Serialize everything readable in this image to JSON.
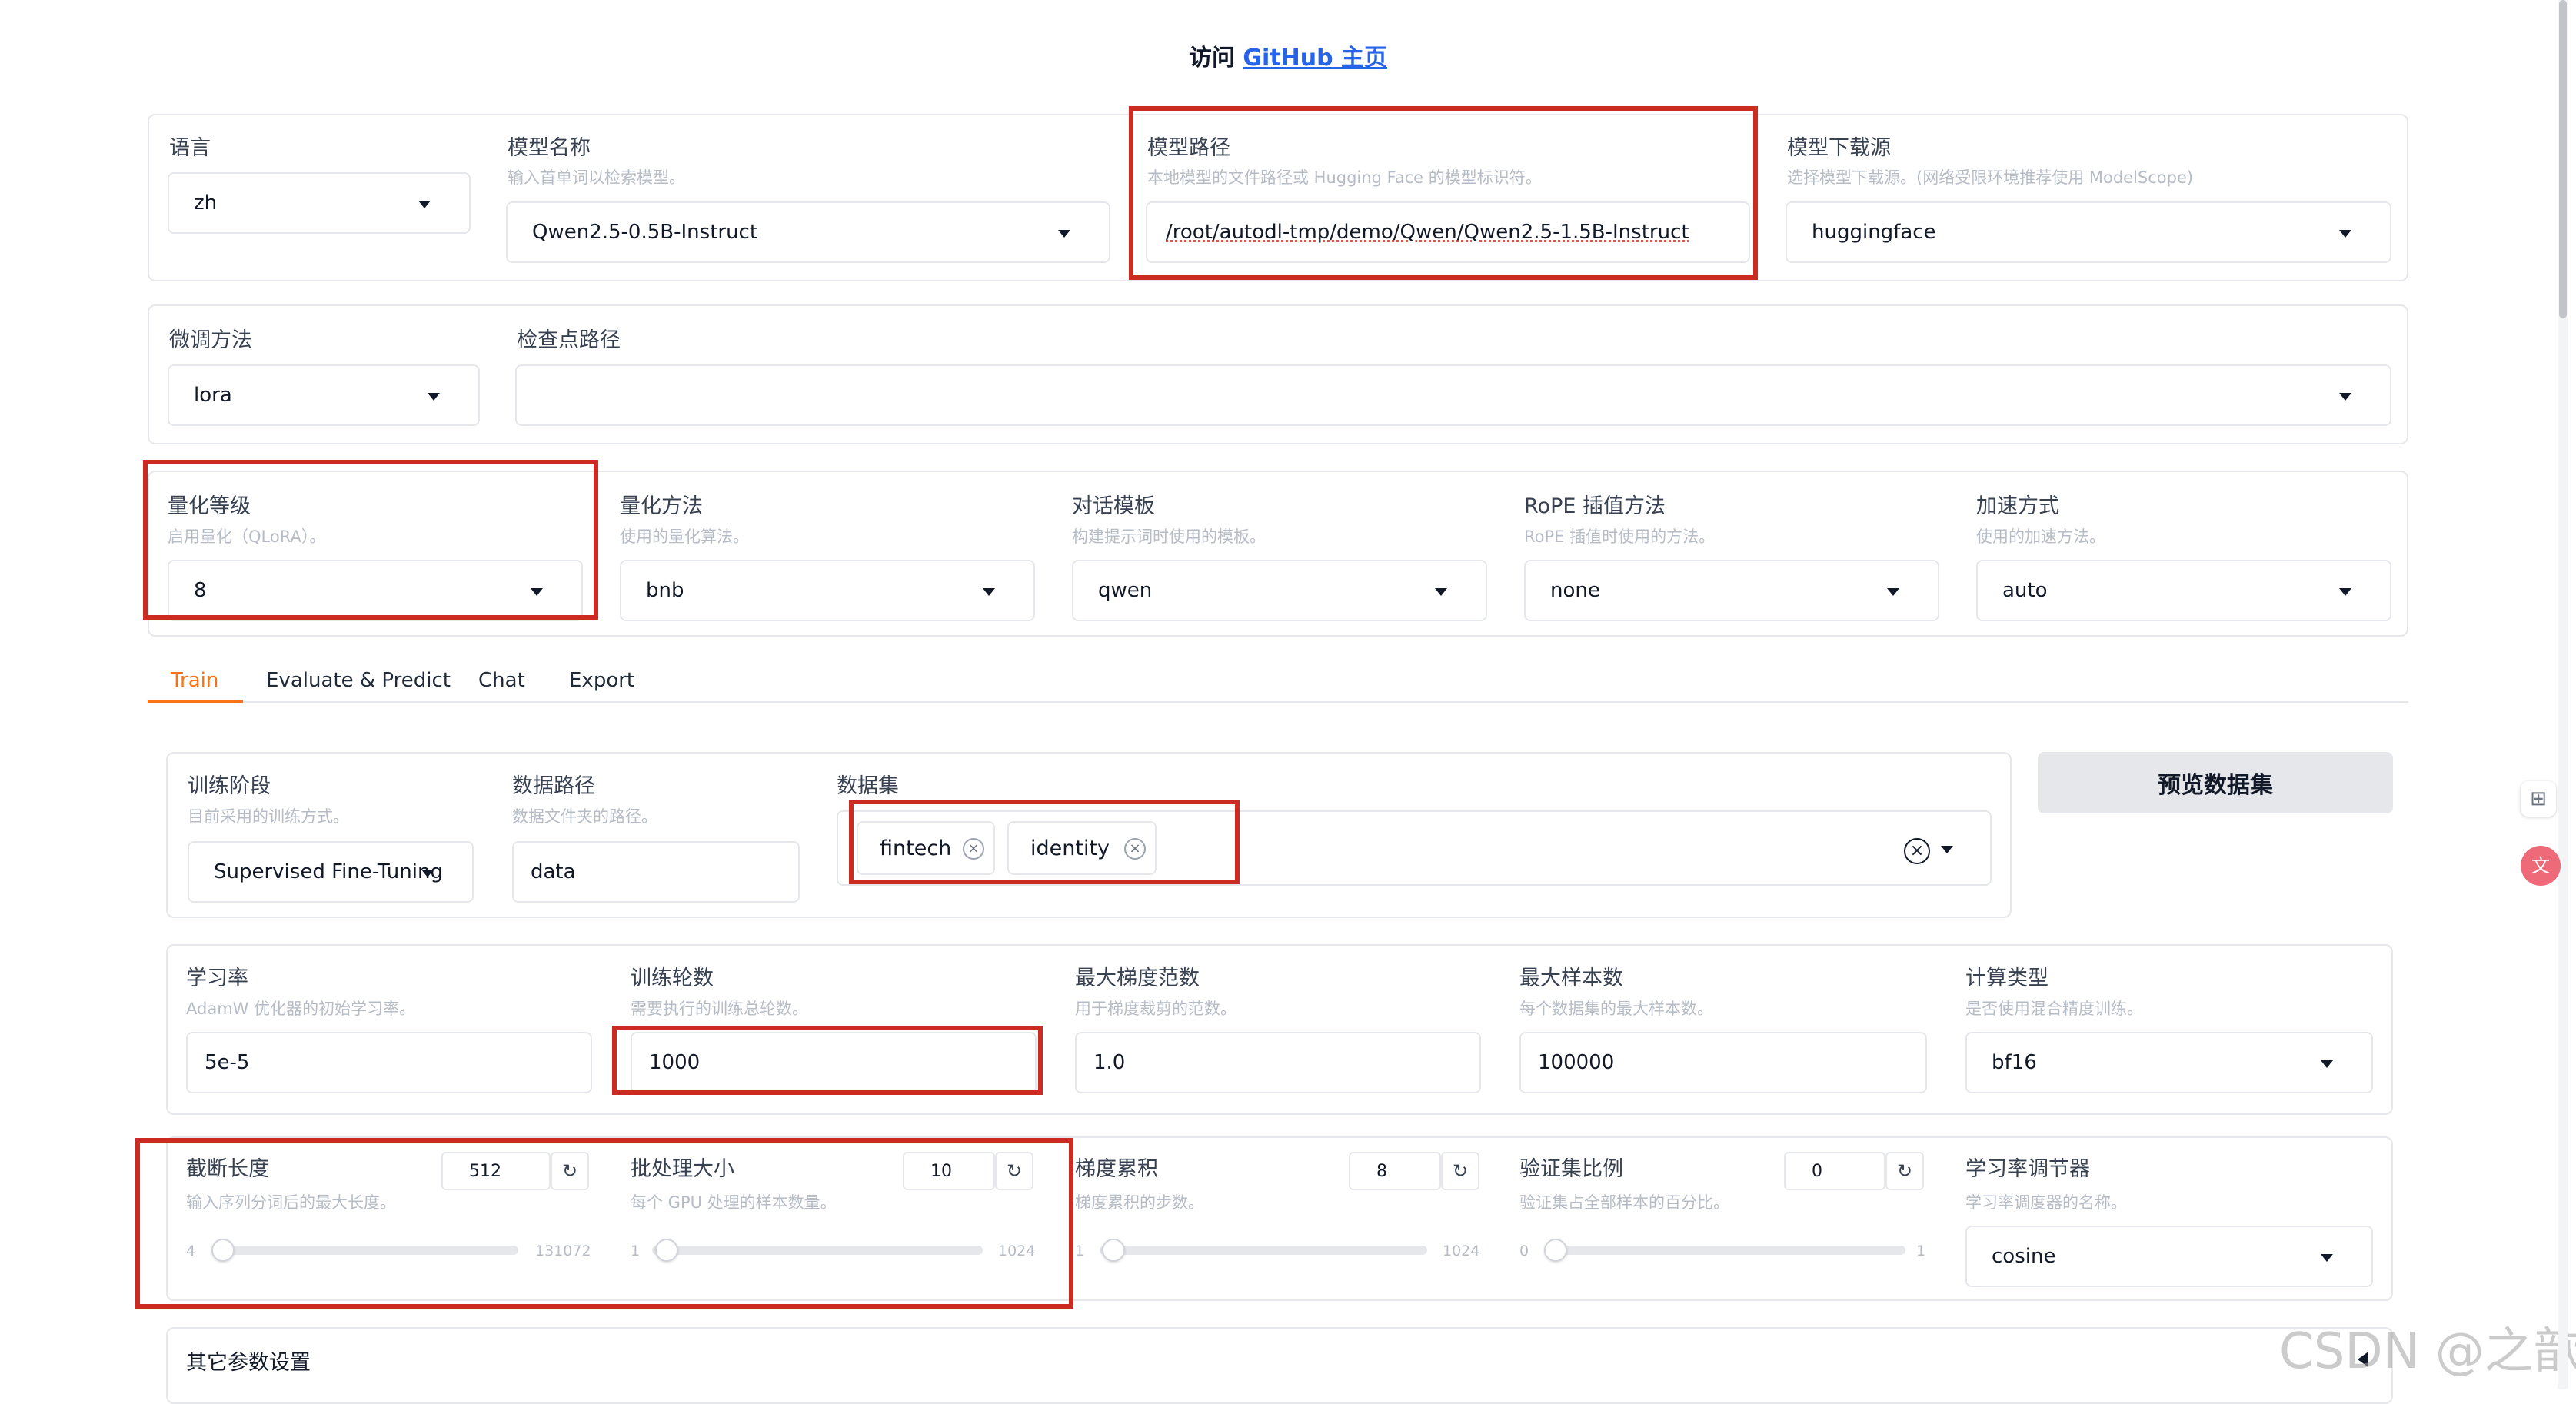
{
  "header": {
    "prefix": "访问",
    "link_text": "GitHub 主页"
  },
  "top": {
    "lang": {
      "label": "语言",
      "value": "zh"
    },
    "model_name": {
      "label": "模型名称",
      "info": "输入首单词以检索模型。",
      "value": "Qwen2.5-0.5B-Instruct"
    },
    "model_path": {
      "label": "模型路径",
      "info": "本地模型的文件路径或 Hugging Face 的模型标识符。",
      "value": "/root/autodl-tmp/demo/Qwen/Qwen2.5-1.5B-Instruct"
    },
    "model_hub": {
      "label": "模型下载源",
      "info": "选择模型下载源。(网络受限环境推荐使用 ModelScope)",
      "value": "huggingface"
    }
  },
  "row2": {
    "finetune": {
      "label": "微调方法",
      "value": "lora"
    },
    "checkpoint": {
      "label": "检查点路径",
      "value": ""
    }
  },
  "row3": {
    "quant_bit": {
      "label": "量化等级",
      "info": "启用量化（QLoRA）。",
      "value": "8"
    },
    "quant_method": {
      "label": "量化方法",
      "info": "使用的量化算法。",
      "value": "bnb"
    },
    "template": {
      "label": "对话模板",
      "info": "构建提示词时使用的模板。",
      "value": "qwen"
    },
    "rope": {
      "label": "RoPE 插值方法",
      "info": "RoPE 插值时使用的方法。",
      "value": "none"
    },
    "booster": {
      "label": "加速方式",
      "info": "使用的加速方法。",
      "value": "auto"
    }
  },
  "tabs": [
    "Train",
    "Evaluate & Predict",
    "Chat",
    "Export"
  ],
  "train": {
    "stage": {
      "label": "训练阶段",
      "info": "目前采用的训练方式。",
      "value": "Supervised Fine-Tuning"
    },
    "dataset_dir": {
      "label": "数据路径",
      "info": "数据文件夹的路径。",
      "value": "data"
    },
    "dataset": {
      "label": "数据集",
      "chips": [
        "fintech",
        "identity"
      ]
    },
    "preview_button": "预览数据集",
    "lr": {
      "label": "学习率",
      "info": "AdamW 优化器的初始学习率。",
      "value": "5e-5"
    },
    "epochs": {
      "label": "训练轮数",
      "info": "需要执行的训练总轮数。",
      "value": "1000"
    },
    "max_grad_norm": {
      "label": "最大梯度范数",
      "info": "用于梯度裁剪的范数。",
      "value": "1.0"
    },
    "max_samples": {
      "label": "最大样本数",
      "info": "每个数据集的最大样本数。",
      "value": "100000"
    },
    "compute_type": {
      "label": "计算类型",
      "info": "是否使用混合精度训练。",
      "value": "bf16"
    },
    "cutoff": {
      "label": "截断长度",
      "info": "输入序列分词后的最大长度。",
      "value": "512",
      "min": "4",
      "max": "131072",
      "level": 0.004
    },
    "batch": {
      "label": "批处理大小",
      "info": "每个 GPU 处理的样本数量。",
      "value": "10",
      "min": "1",
      "max": "1024",
      "level": 0.009
    },
    "grad_accum": {
      "label": "梯度累积",
      "info": "梯度累积的步数。",
      "value": "8",
      "min": "1",
      "max": "1024",
      "level": 0.007
    },
    "val_size": {
      "label": "验证集比例",
      "info": "验证集占全部样本的百分比。",
      "value": "0",
      "min": "0",
      "max": "1",
      "level": 0
    },
    "scheduler": {
      "label": "学习率调节器",
      "info": "学习率调度器的名称。",
      "value": "cosine"
    },
    "extra": {
      "label": "其它参数设置"
    }
  },
  "watermark": "CSDN @之歆",
  "icons": {
    "reset": "reset-icon",
    "dropdown": "chevron-down-icon",
    "clear": "close-icon"
  },
  "colors": {
    "accent": "#f97316",
    "highlight": "#cc2b22",
    "link": "#2563eb"
  }
}
